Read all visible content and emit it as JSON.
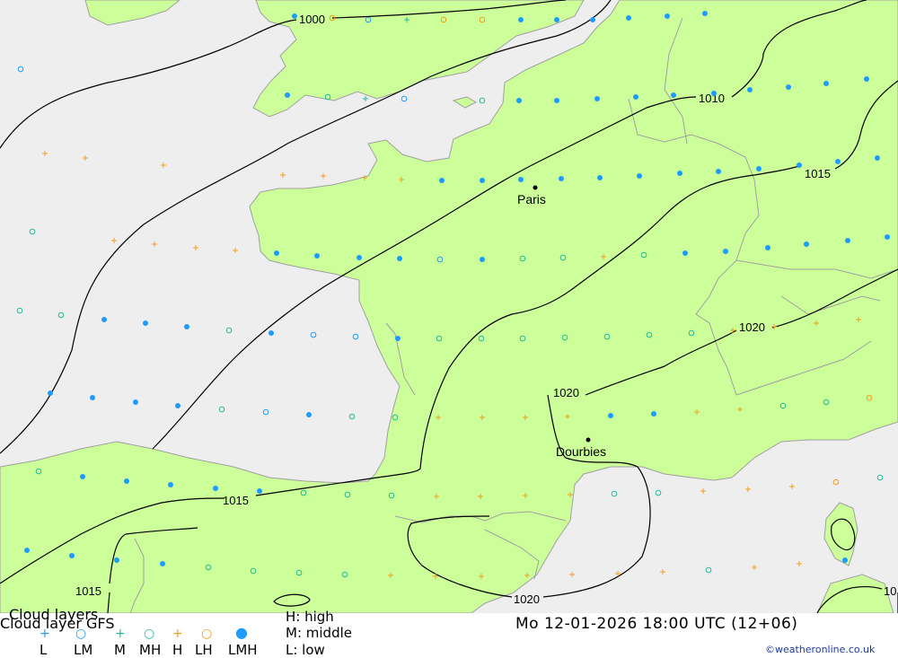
{
  "map": {
    "colors": {
      "sea": "#eeeeee",
      "land": "#ccff99",
      "coast": "#a0a0a0",
      "isobar": "#000000",
      "high": "#1e9bff",
      "middle": "#22bb99",
      "low": "#f0a020"
    },
    "cities": [
      {
        "name": "Paris"
      },
      {
        "name": "Dourbies"
      }
    ],
    "isobar_labels": [
      "1000",
      "1010",
      "1015",
      "1015",
      "1020",
      "1020",
      "1015",
      "1015",
      "1020",
      "10"
    ]
  },
  "legend": {
    "title_overlay": "Cloud layers",
    "title": "Cloud layer   GFS",
    "codes": [
      "L",
      "LM",
      "M",
      "MH",
      "H",
      "LH",
      "LMH"
    ],
    "key_high": "H:  high",
    "key_middle": "M:  middle",
    "key_low": "L:  low",
    "datetime": "Mo 12-01-2026 18:00 UTC (12+06)",
    "credit": "©weatheronline.co.uk"
  }
}
